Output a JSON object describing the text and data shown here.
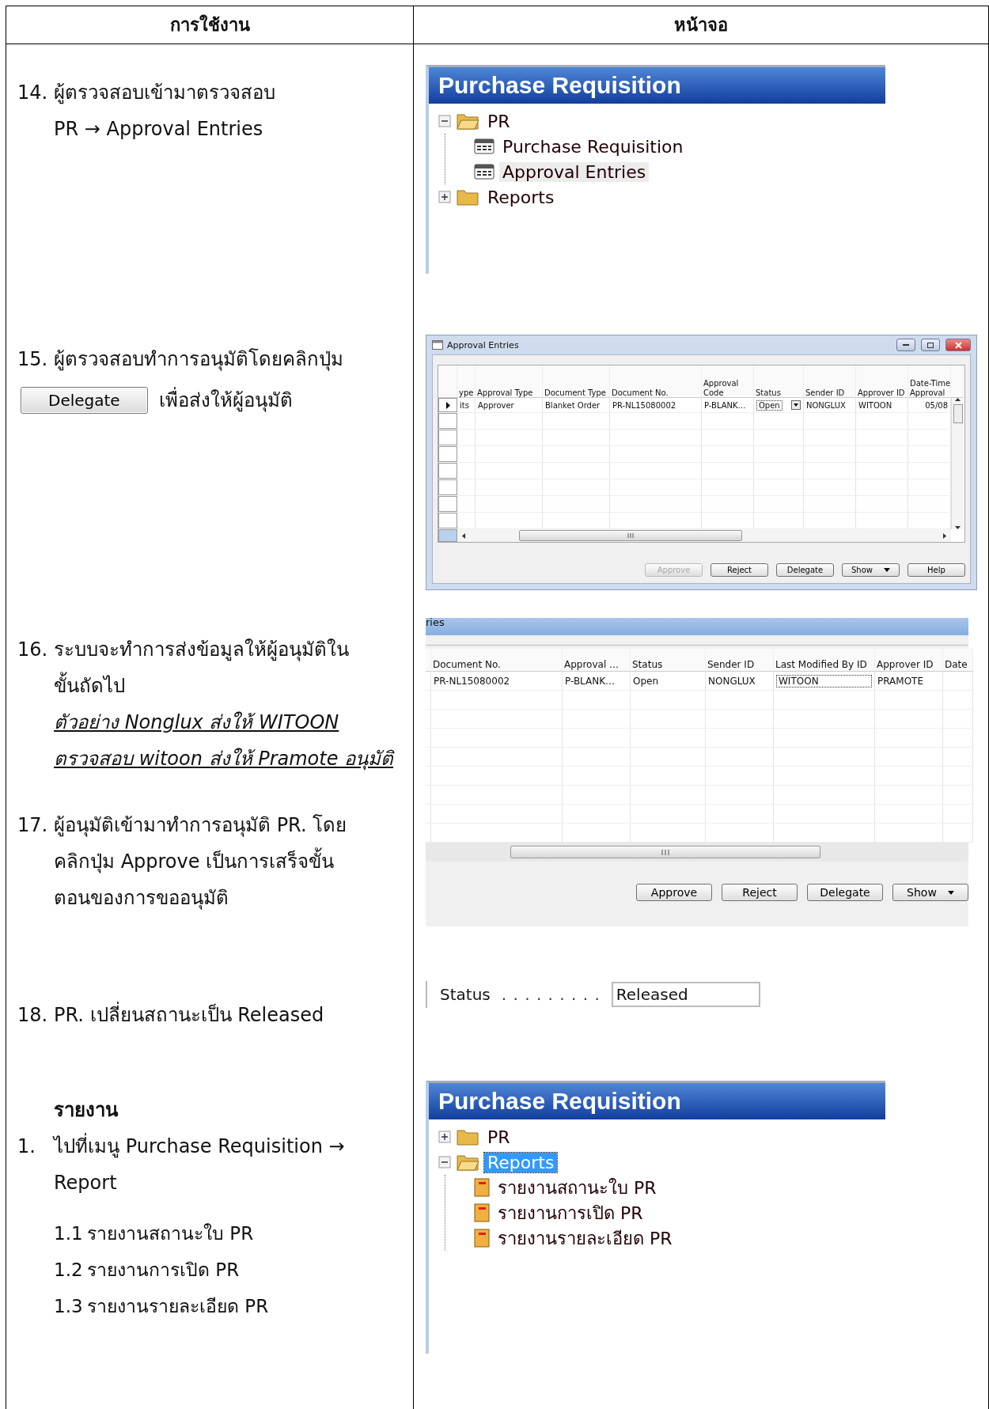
{
  "table": {
    "columns": [
      {
        "title": "การใช้งาน"
      },
      {
        "title": "หน้าจอ"
      }
    ]
  },
  "rows": [
    {
      "kind": "steps",
      "steps": [
        {
          "number": "14.",
          "parts": [
            {
              "kind": "text",
              "text": "ผู้ตรวจสอบเข้ามาตรวจสอบ"
            },
            {
              "kind": "text",
              "text": "PR → Approval Entries"
            }
          ]
        }
      ],
      "screen": {
        "kind": "nav_pane",
        "title": "Purchase Requisition",
        "tree": [
          {
            "label": "PR",
            "kind": "folder",
            "expanded": true,
            "selected": false,
            "hovered": false,
            "children": [
              {
                "label": "Purchase Requisition",
                "kind": "form",
                "selected": false,
                "hovered": false
              },
              {
                "label": "Approval Entries",
                "kind": "form",
                "selected": false,
                "hovered": true
              }
            ]
          },
          {
            "label": "Reports",
            "kind": "folder",
            "expanded": false,
            "selected": false,
            "hovered": false
          }
        ]
      }
    },
    {
      "kind": "steps",
      "steps": [
        {
          "number": "15.",
          "parts": [
            {
              "kind": "text",
              "text": "ผู้ตรวจสอบทำการอนุมัติโดยคลิกปุ่ม"
            },
            {
              "kind": "button_line",
              "button": "Delegate",
              "text": "เพื่อส่งให้ผู้อนุมัติ"
            }
          ]
        }
      ],
      "screen": {
        "kind": "window",
        "title": "Approval Entries",
        "columns": [
          {
            "title": "ype"
          },
          {
            "title": "Approval Type"
          },
          {
            "title": "Document Type"
          },
          {
            "title": "Document No."
          },
          {
            "title": "Approval\nCode"
          },
          {
            "title": "Status"
          },
          {
            "title": "Sender ID"
          },
          {
            "title": "Approver ID"
          },
          {
            "title": "Date-Time\nApproval"
          }
        ],
        "rows": [
          [
            "its",
            "Approver",
            "Blanket Order",
            "PR-NL15080002",
            "P-BLANK…",
            "Open",
            "NONGLUX",
            "WITOON",
            "05/08"
          ]
        ],
        "buttons": [
          {
            "label": "Approve",
            "disabled": true,
            "dropdown": false
          },
          {
            "label": "Reject",
            "disabled": false,
            "dropdown": false
          },
          {
            "label": "Delegate",
            "disabled": false,
            "dropdown": false
          },
          {
            "label": "Show",
            "disabled": false,
            "dropdown": true
          },
          {
            "label": "Help",
            "disabled": false,
            "dropdown": false
          }
        ]
      }
    },
    {
      "kind": "steps",
      "steps": [
        {
          "number": "16.",
          "parts": [
            {
              "kind": "text",
              "text": "ระบบจะทำการส่งข้อมูลให้ผู้อนุมัติในขั้นถัดไป"
            },
            {
              "kind": "example",
              "text": "ตัวอย่าง Nonglux ส่งให้ WITOON"
            },
            {
              "kind": "example",
              "text": "ตรวจสอบ witoon ส่งให้ Pramote อนุมัติ"
            }
          ]
        },
        {
          "number": "17.",
          "parts": [
            {
              "kind": "text",
              "text": "ผู้อนุมัติเข้ามาทำการอนุมัติ PR. โดยคลิกปุ่ม Approve เป็นการเสร็จขั้นตอนของการขออนุมัติ"
            }
          ]
        }
      ],
      "screen": {
        "kind": "grid",
        "title": "ries",
        "columns": [
          {
            "title": "Document No."
          },
          {
            "title": "Approval …"
          },
          {
            "title": "Status"
          },
          {
            "title": "Sender ID"
          },
          {
            "title": "Last Modified By ID"
          },
          {
            "title": "Approver ID"
          },
          {
            "title": "Date"
          }
        ],
        "rows": [
          [
            "PR-NL15080002",
            "P-BLANK…",
            "Open",
            "NONGLUX",
            "WITOON",
            "PRAMOTE",
            ""
          ]
        ],
        "buttons": [
          {
            "label": "Approve",
            "disabled": false,
            "dropdown": false
          },
          {
            "label": "Reject",
            "disabled": false,
            "dropdown": false
          },
          {
            "label": "Delegate",
            "disabled": false,
            "dropdown": false
          },
          {
            "label": "Show",
            "disabled": false,
            "dropdown": true
          }
        ]
      }
    },
    {
      "kind": "steps",
      "steps": [
        {
          "number": "18.",
          "parts": [
            {
              "kind": "text",
              "text": "PR. เปลี่ยนสถานะเป็น Released"
            }
          ]
        }
      ],
      "screen": {
        "kind": "field",
        "label": "Status",
        "leader": ". . . . . . . . .",
        "value": "Released"
      }
    },
    {
      "kind": "report",
      "heading": "รายงาน",
      "steps": [
        {
          "number": "1.",
          "parts": [
            {
              "kind": "text",
              "text": "ไปที่เมนู Purchase Requisition → Report"
            }
          ]
        }
      ],
      "items": [
        {
          "number": "1.1",
          "text": "รายงานสถานะใบ PR"
        },
        {
          "number": "1.2",
          "text": "รายงานการเปิด PR"
        },
        {
          "number": "1.3",
          "text": "รายงานรายละเอียด PR"
        }
      ],
      "screen": {
        "kind": "nav_pane",
        "title": "Purchase Requisition",
        "tree": [
          {
            "label": "PR",
            "kind": "folder",
            "expanded": false,
            "selected": false,
            "hovered": false
          },
          {
            "label": "Reports",
            "kind": "folder",
            "expanded": true,
            "selected": true,
            "hovered": false,
            "children": [
              {
                "label": "รายงานสถานะใบ PR",
                "kind": "report",
                "selected": false,
                "hovered": false
              },
              {
                "label": "รายงานการเปิด PR",
                "kind": "report",
                "selected": false,
                "hovered": false
              },
              {
                "label": "รายงานรายละเอียด PR",
                "kind": "report",
                "selected": false,
                "hovered": false
              }
            ]
          }
        ]
      }
    }
  ]
}
